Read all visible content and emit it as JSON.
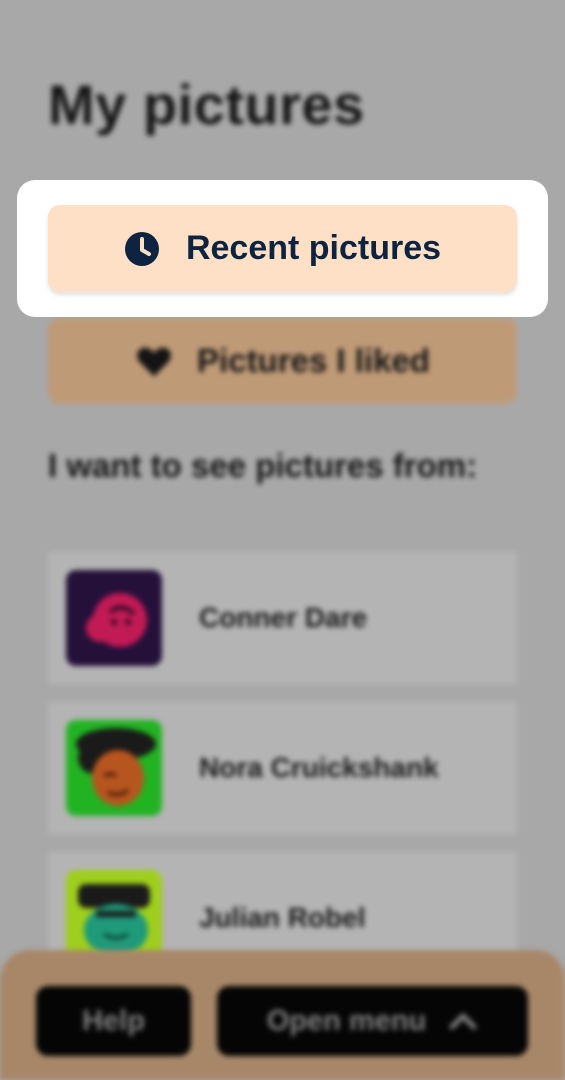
{
  "page": {
    "title": "My pictures"
  },
  "nav": {
    "recent_label": "Recent pictures",
    "recent_icon": "clock-icon",
    "liked_label": "Pictures I liked",
    "liked_icon": "heart-icon"
  },
  "filter": {
    "heading": "I want to see pictures from:",
    "users": [
      {
        "name": "Conner Dare",
        "avatar_bg": "#25103a"
      },
      {
        "name": "Nora Cruickshank",
        "avatar_bg": "#22b322"
      },
      {
        "name": "Julian Robel",
        "avatar_bg": "#9fcf1c"
      }
    ]
  },
  "footer": {
    "help_label": "Help",
    "menu_label": "Open menu",
    "menu_icon": "chevron-up-icon"
  },
  "colors": {
    "overlay": "#a8a8a8",
    "highlight_button": "#fde0c5",
    "highlight_text": "#0d2340",
    "secondary_button": "#bf9a77",
    "footer_bar": "#a88768"
  }
}
